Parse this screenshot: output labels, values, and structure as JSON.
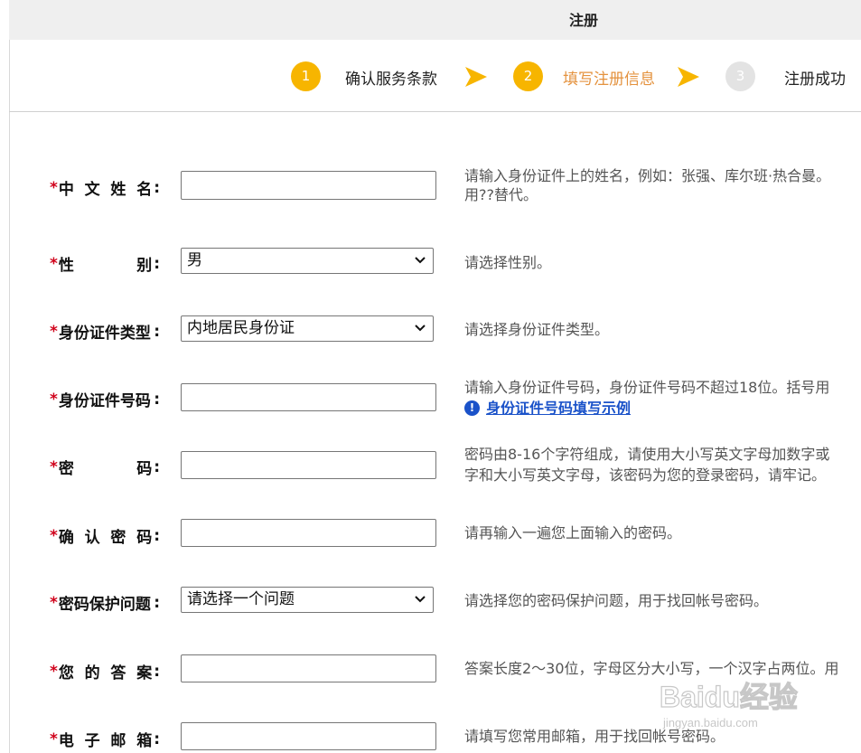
{
  "header": {
    "title": "注册"
  },
  "steps": [
    {
      "number": "1",
      "label": "确认服务条款"
    },
    {
      "number": "2",
      "label": "填写注册信息"
    },
    {
      "number": "3",
      "label": "注册成功"
    }
  ],
  "form": {
    "name": {
      "required": "*",
      "label_chars": [
        "中",
        "文",
        "姓",
        "名"
      ],
      "colon": ":",
      "value": "",
      "hint_line1": "请输入身份证件上的姓名，例如：张强、库尔班·热合曼。",
      "hint_line2": "用??替代。"
    },
    "gender": {
      "required": "*",
      "label_chars": [
        "性",
        "别"
      ],
      "colon": ":",
      "value": "男",
      "hint": "请选择性别。"
    },
    "id_type": {
      "required": "*",
      "label": "身份证件类型",
      "colon": ":",
      "value": "内地居民身份证",
      "hint": "请选择身份证件类型。"
    },
    "id_number": {
      "required": "*",
      "label": "身份证件号码",
      "colon": ":",
      "value": "",
      "hint": "请输入身份证件号码，身份证件号码不超过18位。括号用",
      "link_icon": "!",
      "link": "身份证件号码填写示例"
    },
    "password": {
      "required": "*",
      "label_chars": [
        "密",
        "码"
      ],
      "colon": ":",
      "value": "",
      "hint_line1": "密码由8-16个字符组成，请使用大小写英文字母加数字或",
      "hint_line2": "字和大小写英文字母，该密码为您的登录密码，请牢记。"
    },
    "confirm_password": {
      "required": "*",
      "label_chars": [
        "确",
        "认",
        "密",
        "码"
      ],
      "colon": ":",
      "value": "",
      "hint": "请再输入一遍您上面输入的密码。"
    },
    "security_question": {
      "required": "*",
      "label": "密码保护问题",
      "colon": ":",
      "value": "请选择一个问题",
      "hint": "请选择您的密码保护问题，用于找回帐号密码。"
    },
    "answer": {
      "required": "*",
      "label_chars": [
        "您",
        "的",
        "答",
        "案"
      ],
      "colon": ":",
      "value": "",
      "hint": "答案长度2～30位，字母区分大小写，一个汉字占两位。用"
    },
    "email": {
      "required": "*",
      "label_chars": [
        "电",
        "子",
        "邮",
        "箱"
      ],
      "colon": ":",
      "value": "",
      "hint": "请填写您常用邮箱，用于找回帐号密码。"
    }
  },
  "watermark": {
    "text": "Baidu经验",
    "subtext": "jingyan.baidu.com"
  },
  "colors": {
    "step_active": "#f7b500",
    "step_inactive": "#e3e3e3",
    "step_current_text": "#e4923e",
    "required": "#d0021b",
    "link": "#1a52c9"
  }
}
